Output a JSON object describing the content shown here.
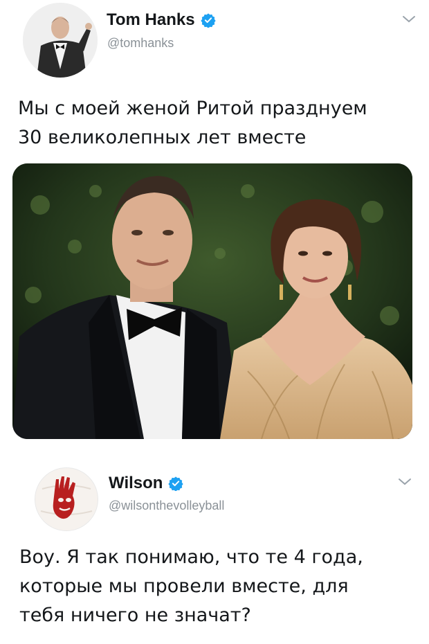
{
  "tweets": [
    {
      "display_name": "Tom Hanks",
      "handle": "@tomhanks",
      "verified": true,
      "text": "Мы с моей женой Ритой празднуем\n30 великолепных лет вместе",
      "has_photo": true
    },
    {
      "display_name": "Wilson",
      "handle": "@wilsonthevolleyball",
      "verified": true,
      "text": "Воу. Я так понимаю, что те 4 года,\nкоторые мы провели вместе, для\nтебя ничего не значат?"
    }
  ],
  "colors": {
    "verified_badge": "#1da1f2",
    "handle_text": "#8a9197",
    "body_text": "#14171a"
  },
  "icons": [
    "verified-badge-icon",
    "chevron-down-icon"
  ]
}
